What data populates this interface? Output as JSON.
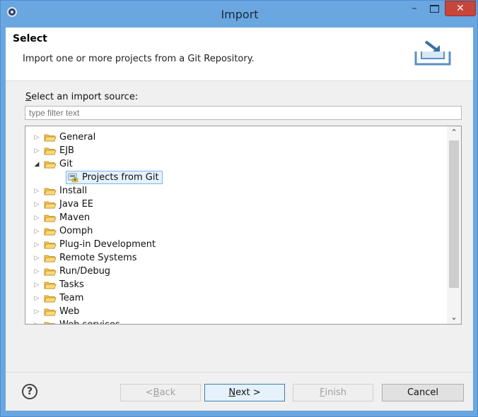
{
  "window": {
    "title": "Import",
    "minimize_glyph": "–",
    "close_glyph": "✕"
  },
  "header": {
    "title": "Select",
    "description": "Import one or more projects from a Git Repository."
  },
  "source": {
    "label_mnemonic": "S",
    "label_rest": "elect an import source:",
    "filter_placeholder": "type filter text"
  },
  "tree": {
    "items": [
      {
        "label": "General",
        "expanded": false
      },
      {
        "label": "EJB",
        "expanded": false
      },
      {
        "label": "Git",
        "expanded": true
      },
      {
        "label": "Projects from Git",
        "child": true,
        "selected": true
      },
      {
        "label": "Install",
        "expanded": false
      },
      {
        "label": "Java EE",
        "expanded": false
      },
      {
        "label": "Maven",
        "expanded": false
      },
      {
        "label": "Oomph",
        "expanded": false
      },
      {
        "label": "Plug-in Development",
        "expanded": false
      },
      {
        "label": "Remote Systems",
        "expanded": false
      },
      {
        "label": "Run/Debug",
        "expanded": false
      },
      {
        "label": "Tasks",
        "expanded": false
      },
      {
        "label": "Team",
        "expanded": false
      },
      {
        "label": "Web",
        "expanded": false
      },
      {
        "label": "Web services",
        "expanded": false
      }
    ]
  },
  "buttons": {
    "help_glyph": "?",
    "back_pre": "< ",
    "back_mnemonic": "B",
    "back_rest": "ack",
    "next_mnemonic": "N",
    "next_rest": "ext >",
    "finish_mnemonic": "F",
    "finish_rest": "inish",
    "cancel": "Cancel"
  },
  "colors": {
    "titlebar": "#6aa6e0",
    "close_button": "#c7463c",
    "selection_border": "#7eb4ea",
    "selection_fill": "#e5f1fb",
    "folder": "#f5c44f"
  }
}
